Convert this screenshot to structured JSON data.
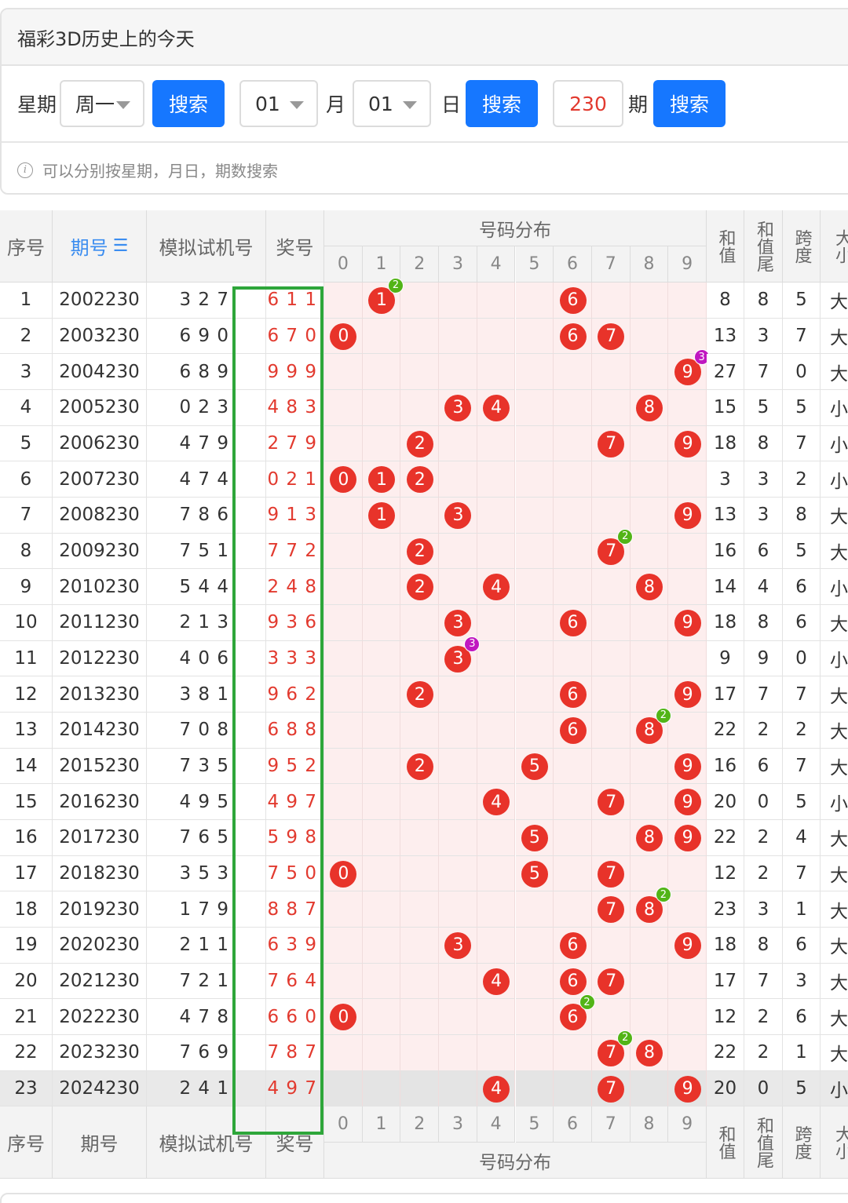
{
  "panel": {
    "title": "福彩3D历史上的今天",
    "weekday_label": "星期",
    "weekday_value": "周一",
    "search_label": "搜索",
    "month_value": "01",
    "month_label": "月",
    "day_value": "01",
    "day_label": "日",
    "issue_value": "230",
    "issue_label": "期",
    "hint": "可以分别按星期，月日，期数搜索",
    "info_icon": "i"
  },
  "table": {
    "headers": {
      "index": "序号",
      "issue": "期号",
      "sort_icon": "☰",
      "sim": "模拟试机号",
      "prize": "奖号",
      "distribution": "号码分布",
      "digits": [
        "0",
        "1",
        "2",
        "3",
        "4",
        "5",
        "6",
        "7",
        "8",
        "9"
      ],
      "sum": "和值",
      "sum_tail": "和值尾",
      "span": "跨度",
      "big_small": "大小"
    },
    "rows": [
      {
        "idx": "1",
        "issue": "2002230",
        "sim": "3 2 7",
        "prize": "6 1 1",
        "sum": "8",
        "tail": "8",
        "span": "5",
        "bs": "大"
      },
      {
        "idx": "2",
        "issue": "2003230",
        "sim": "6 9 0",
        "prize": "6 7 0",
        "sum": "13",
        "tail": "3",
        "span": "7",
        "bs": "大"
      },
      {
        "idx": "3",
        "issue": "2004230",
        "sim": "6 8 9",
        "prize": "9 9 9",
        "sum": "27",
        "tail": "7",
        "span": "0",
        "bs": "大"
      },
      {
        "idx": "4",
        "issue": "2005230",
        "sim": "0 2 3",
        "prize": "4 8 3",
        "sum": "15",
        "tail": "5",
        "span": "5",
        "bs": "小"
      },
      {
        "idx": "5",
        "issue": "2006230",
        "sim": "4 7 9",
        "prize": "2 7 9",
        "sum": "18",
        "tail": "8",
        "span": "7",
        "bs": "小"
      },
      {
        "idx": "6",
        "issue": "2007230",
        "sim": "4 7 4",
        "prize": "0 2 1",
        "sum": "3",
        "tail": "3",
        "span": "2",
        "bs": "小"
      },
      {
        "idx": "7",
        "issue": "2008230",
        "sim": "7 8 6",
        "prize": "9 1 3",
        "sum": "13",
        "tail": "3",
        "span": "8",
        "bs": "大"
      },
      {
        "idx": "8",
        "issue": "2009230",
        "sim": "7 5 1",
        "prize": "7 7 2",
        "sum": "16",
        "tail": "6",
        "span": "5",
        "bs": "大"
      },
      {
        "idx": "9",
        "issue": "2010230",
        "sim": "5 4 4",
        "prize": "2 4 8",
        "sum": "14",
        "tail": "4",
        "span": "6",
        "bs": "小"
      },
      {
        "idx": "10",
        "issue": "2011230",
        "sim": "2 1 3",
        "prize": "9 3 6",
        "sum": "18",
        "tail": "8",
        "span": "6",
        "bs": "大"
      },
      {
        "idx": "11",
        "issue": "2012230",
        "sim": "4 0 6",
        "prize": "3 3 3",
        "sum": "9",
        "tail": "9",
        "span": "0",
        "bs": "小"
      },
      {
        "idx": "12",
        "issue": "2013230",
        "sim": "3 8 1",
        "prize": "9 6 2",
        "sum": "17",
        "tail": "7",
        "span": "7",
        "bs": "大"
      },
      {
        "idx": "13",
        "issue": "2014230",
        "sim": "7 0 8",
        "prize": "6 8 8",
        "sum": "22",
        "tail": "2",
        "span": "2",
        "bs": "大"
      },
      {
        "idx": "14",
        "issue": "2015230",
        "sim": "7 3 5",
        "prize": "9 5 2",
        "sum": "16",
        "tail": "6",
        "span": "7",
        "bs": "大"
      },
      {
        "idx": "15",
        "issue": "2016230",
        "sim": "4 9 5",
        "prize": "4 9 7",
        "sum": "20",
        "tail": "0",
        "span": "5",
        "bs": "小"
      },
      {
        "idx": "16",
        "issue": "2017230",
        "sim": "7 6 5",
        "prize": "5 9 8",
        "sum": "22",
        "tail": "2",
        "span": "4",
        "bs": "大"
      },
      {
        "idx": "17",
        "issue": "2018230",
        "sim": "3 5 3",
        "prize": "7 5 0",
        "sum": "12",
        "tail": "2",
        "span": "7",
        "bs": "大"
      },
      {
        "idx": "18",
        "issue": "2019230",
        "sim": "1 7 9",
        "prize": "8 8 7",
        "sum": "23",
        "tail": "3",
        "span": "1",
        "bs": "大"
      },
      {
        "idx": "19",
        "issue": "2020230",
        "sim": "2 1 1",
        "prize": "6 3 9",
        "sum": "18",
        "tail": "8",
        "span": "6",
        "bs": "大"
      },
      {
        "idx": "20",
        "issue": "2021230",
        "sim": "7 2 1",
        "prize": "7 6 4",
        "sum": "17",
        "tail": "7",
        "span": "3",
        "bs": "大"
      },
      {
        "idx": "21",
        "issue": "2022230",
        "sim": "4 7 8",
        "prize": "6 6 0",
        "sum": "12",
        "tail": "2",
        "span": "6",
        "bs": "大"
      },
      {
        "idx": "22",
        "issue": "2023230",
        "sim": "7 6 9",
        "prize": "7 8 7",
        "sum": "22",
        "tail": "2",
        "span": "1",
        "bs": "大"
      },
      {
        "idx": "23",
        "issue": "2024230",
        "sim": "2 4 1",
        "prize": "4 9 7",
        "sum": "20",
        "tail": "0",
        "span": "5",
        "bs": "小"
      }
    ]
  },
  "colors": {
    "accent_blue": "#1677ff",
    "prize_red": "#e23a2f",
    "ball_red": "#e8332a",
    "repeat2_green": "#52b417",
    "repeat3_magenta": "#c018c0",
    "highlight_frame_green": "#2ea63a",
    "dist_bg_pink": "#fdeeee"
  }
}
